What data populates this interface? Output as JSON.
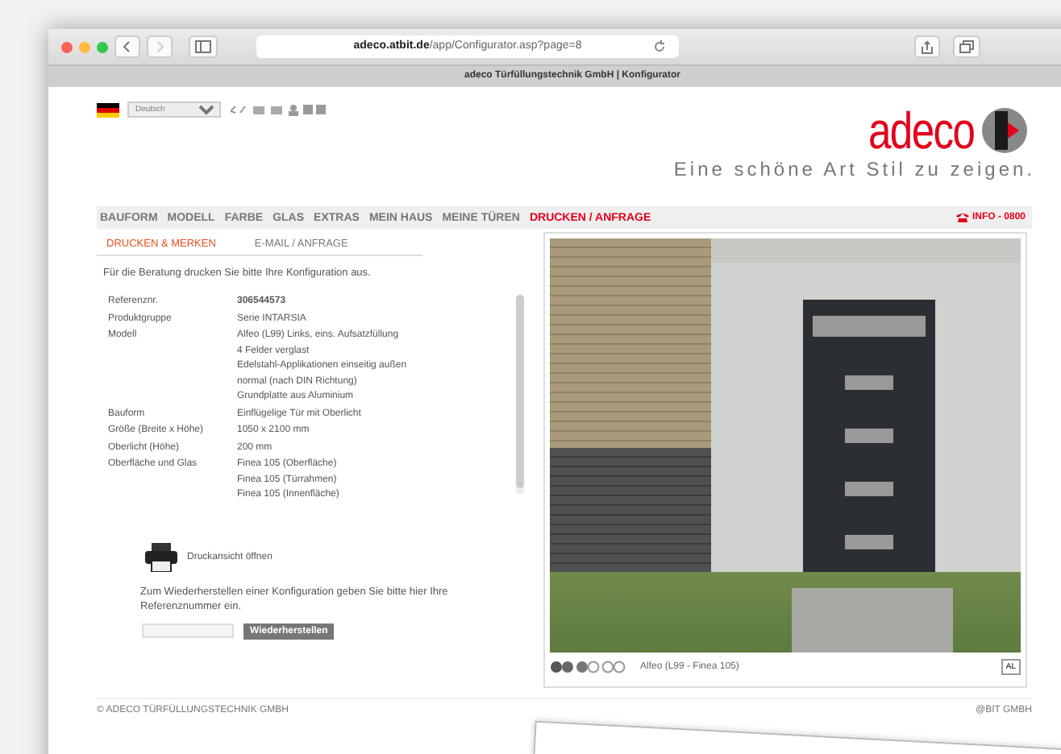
{
  "browser": {
    "url_domain": "adeco.atbit.de",
    "url_path": "/app/Configurator.asp?page=8",
    "tab_title": "adeco Türfüllungstechnik GmbH | Konfigurator"
  },
  "header": {
    "language": "Deutsch",
    "logo": "adeco",
    "tagline": "Eine schöne Art Stil zu zeigen."
  },
  "nav": [
    {
      "label": "BAUFORM",
      "selected": false
    },
    {
      "label": "MODELL",
      "selected": false
    },
    {
      "label": "FARBE",
      "selected": false
    },
    {
      "label": "GLAS",
      "selected": false
    },
    {
      "label": "EXTRAS",
      "selected": false
    },
    {
      "label": "MEIN HAUS",
      "selected": false
    },
    {
      "label": "MEINE TÜREN",
      "selected": false
    },
    {
      "label": "DRUCKEN / ANFRAGE",
      "selected": true
    }
  ],
  "info": "INFO - 0800",
  "subtabs": [
    {
      "label": "DRUCKEN & MERKEN",
      "selected": true
    },
    {
      "label": "E-MAIL / ANFRAGE",
      "selected": false
    }
  ],
  "intro": "Für die Beratung drucken Sie bitte Ihre Konfiguration aus.",
  "details": [
    {
      "label": "Referenznr.",
      "values": [
        "**306544573**"
      ]
    },
    {
      "label": "Produktgruppe",
      "values": [
        "Serie INTARSIA"
      ]
    },
    {
      "label": "Modell",
      "values": [
        "Alfeo (L99) Links, eins. Aufsatzfüllung",
        "4 Felder verglast",
        "Edelstahl-Applikationen einseitig außen",
        "normal (nach DIN Richtung)",
        "Grundplatte aus Aluminium"
      ]
    },
    {
      "label": "Bauform",
      "values": [
        "Einflügelige Tür mit Oberlicht"
      ]
    },
    {
      "label": "Größe (Breite x Höhe)",
      "values": [
        "1050 x 2100 mm"
      ]
    },
    {
      "label": "Oberlicht (Höhe)",
      "values": [
        "200 mm"
      ]
    },
    {
      "label": "Oberfläche und Glas",
      "values": [
        "Finea 105 (Oberfläche)",
        "Finea 105 (Türrahmen)",
        "Finea 105 (Innenfläche)"
      ]
    }
  ],
  "print_link": "Druckansicht öffnen",
  "restore_text": "Zum Wiederherstellen einer Konfiguration geben Sie bitte hier Ihre Referenznummer ein.",
  "restore_button": "Wiederherstellen",
  "photo_caption": "Alfeo (L99 - Finea 105)",
  "view_button": "AL",
  "footer_left": "© ADECO TÜRFÜLLUNGSTECHNIK GMBH",
  "footer_right": "@BIT GMBH"
}
